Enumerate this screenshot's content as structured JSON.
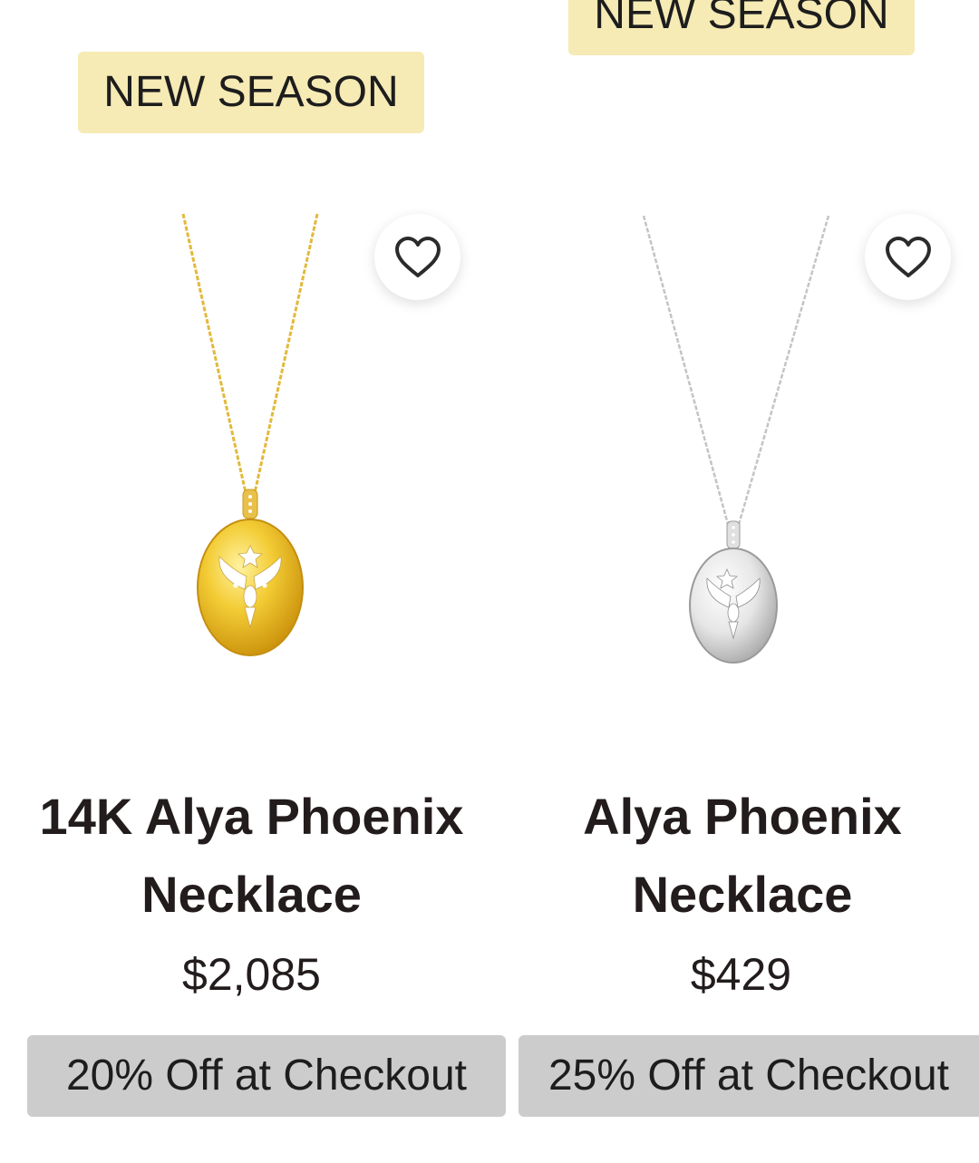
{
  "products": [
    {
      "badge": "NEW SEASON",
      "name_line1": "14K Alya Phoenix",
      "name_line2": "Necklace",
      "price": "$2,085",
      "promo": "20% Off at Checkout",
      "metal": "gold",
      "wishlist_icon": "heart-outline-icon"
    },
    {
      "badge": "NEW SEASON",
      "name_line1": "Alya Phoenix",
      "name_line2": "Necklace",
      "price": "$429",
      "promo": "25% Off at Checkout",
      "metal": "silver",
      "wishlist_icon": "heart-outline-icon"
    }
  ],
  "colors": {
    "badge_bg": "#f6eab5",
    "promo_bg": "#cccccc",
    "text": "#231c1c",
    "gold": "#e8b820",
    "silver": "#d6d6d6"
  }
}
